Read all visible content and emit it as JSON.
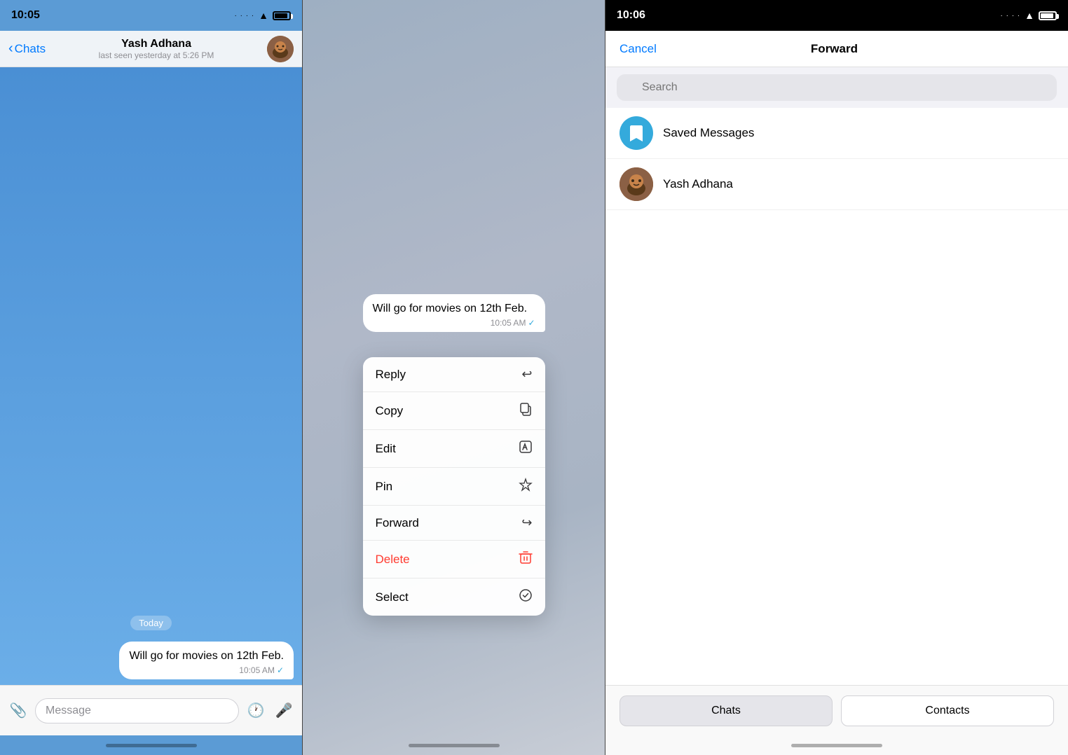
{
  "panel1": {
    "status_time": "10:05",
    "contact_name": "Yash Adhana",
    "contact_status": "last seen yesterday at 5:26 PM",
    "back_label": "Chats",
    "date_badge": "Today",
    "message_text": "Will go for movies on 12th Feb.",
    "message_time": "10:05 AM",
    "input_placeholder": "Message"
  },
  "panel2": {
    "message_text": "Will go for movies on 12th Feb.",
    "message_time": "10:05 AM",
    "menu_items": [
      {
        "label": "Reply",
        "icon": "↩"
      },
      {
        "label": "Copy",
        "icon": "⧉"
      },
      {
        "label": "Edit",
        "icon": "✏"
      },
      {
        "label": "Pin",
        "icon": "📌"
      },
      {
        "label": "Forward",
        "icon": "↪"
      },
      {
        "label": "Delete",
        "icon": "🗑",
        "danger": true
      },
      {
        "label": "Select",
        "icon": "✓"
      }
    ]
  },
  "panel3": {
    "status_time": "10:06",
    "cancel_label": "Cancel",
    "title": "Forward",
    "search_placeholder": "Search",
    "contacts": [
      {
        "name": "Saved Messages",
        "type": "saved"
      },
      {
        "name": "Yash Adhana",
        "type": "user"
      }
    ],
    "tab_chats": "Chats",
    "tab_contacts": "Contacts"
  }
}
